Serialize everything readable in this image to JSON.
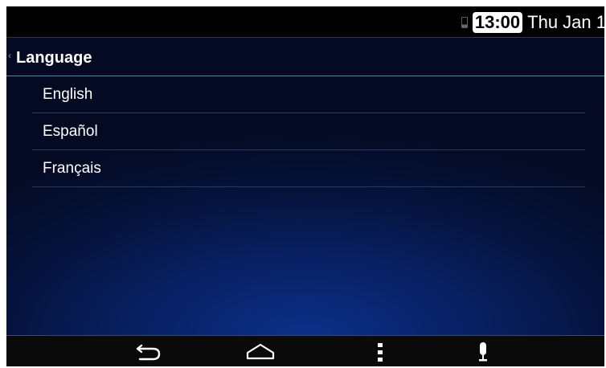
{
  "status_bar": {
    "clock": "13:00",
    "date": "Thu Jan 1"
  },
  "header": {
    "back_glyph": "‹",
    "title": "Language"
  },
  "languages": [
    {
      "label": "English"
    },
    {
      "label": "Español"
    },
    {
      "label": "Français"
    }
  ],
  "nav_bar": {
    "buttons": [
      "back-icon",
      "home-icon",
      "menu-icon",
      "microphone-icon"
    ]
  },
  "colors": {
    "status_bar_bg": "#000000",
    "content_bg": "#05123a",
    "nav_bar_bg": "#0a0a0a",
    "text": "#ffffff"
  }
}
